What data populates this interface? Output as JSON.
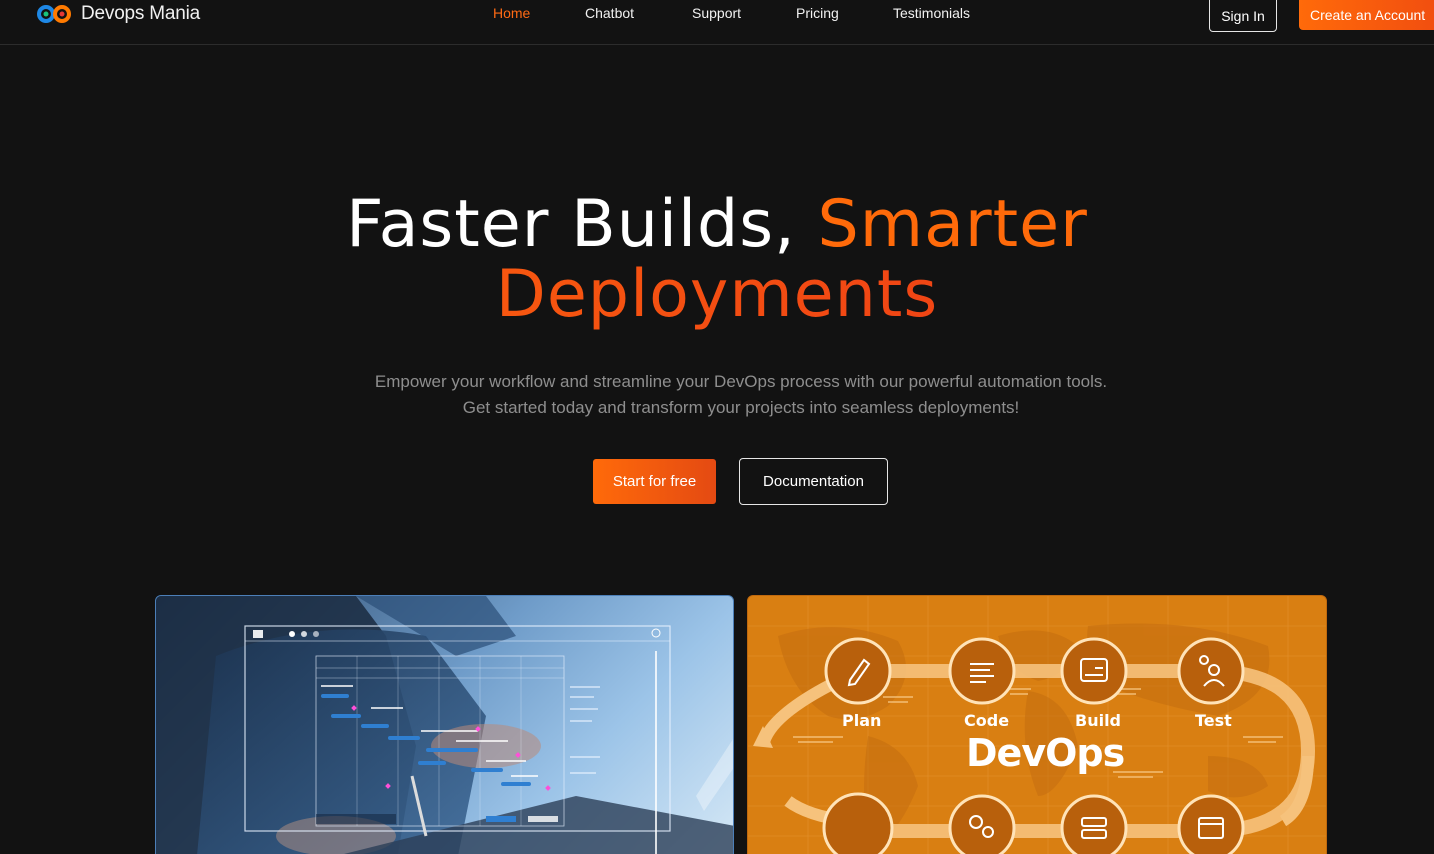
{
  "brand": {
    "name": "Devops Mania"
  },
  "nav": {
    "links": [
      {
        "label": "Home",
        "active": true
      },
      {
        "label": "Chatbot",
        "active": false
      },
      {
        "label": "Support",
        "active": false
      },
      {
        "label": "Pricing",
        "active": false
      },
      {
        "label": "Testimonials",
        "active": false
      }
    ],
    "signin_label": "Sign In",
    "create_label": "Create an Account"
  },
  "hero": {
    "title_white": "Faster Builds,",
    "title_accent": "Smarter",
    "title_line2": "Deployments",
    "subtitle_line1": "Empower your workflow and streamline your DevOps process with our powerful automation tools.",
    "subtitle_line2": "Get started today and transform your projects into seamless deployments!",
    "start_label": "Start for free",
    "docs_label": "Documentation"
  },
  "devops_card": {
    "title": "DevOps",
    "steps": [
      {
        "label": "Plan",
        "icon": "pencil-icon"
      },
      {
        "label": "Code",
        "icon": "code-lines-icon"
      },
      {
        "label": "Build",
        "icon": "build-window-icon"
      },
      {
        "label": "Test",
        "icon": "user-check-icon"
      }
    ]
  },
  "colors": {
    "accent": "#ff6a0a",
    "background": "#121212",
    "muted_text": "#8e8e8e",
    "devops_orange": "#d97f12"
  }
}
